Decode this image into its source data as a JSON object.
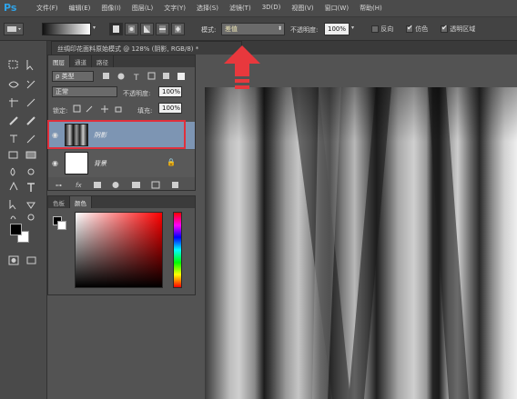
{
  "app": {
    "logo": "Ps"
  },
  "menu": [
    "文件(F)",
    "编辑(E)",
    "图像(I)",
    "图层(L)",
    "文字(Y)",
    "选择(S)",
    "滤镜(T)",
    "3D(D)",
    "视图(V)",
    "窗口(W)",
    "帮助(H)"
  ],
  "options": {
    "mode_label": "模式:",
    "mode_value": "差值",
    "opacity_label": "不透明度:",
    "opacity_value": "100%",
    "reverse_label": "反向",
    "dither_label": "仿色",
    "transparency_label": "透明区域"
  },
  "document": {
    "tab_title": "丝绸印花面料原始模式 @ 128% (阴影, RGB/8) *"
  },
  "layers_panel": {
    "tabs": [
      "图层",
      "通道",
      "路径"
    ],
    "filter_label": "ρ 类型",
    "blend_mode": "正常",
    "opacity_label": "不透明度:",
    "opacity_value": "100%",
    "lock_label": "锁定:",
    "fill_label": "填充:",
    "fill_value": "100%",
    "layers": [
      {
        "name": "阴影",
        "selected": true
      },
      {
        "name": "背景",
        "selected": false,
        "locked": true
      }
    ]
  },
  "color_panel": {
    "tabs": [
      "色板",
      "颜色"
    ],
    "foreground": "#000000",
    "background": "#ffffff"
  },
  "colors": {
    "highlight_border": "#e0303c",
    "arrow_red": "#e8383d",
    "selected_layer": "#7d95b3",
    "logo_blue": "#2fa3e8"
  }
}
